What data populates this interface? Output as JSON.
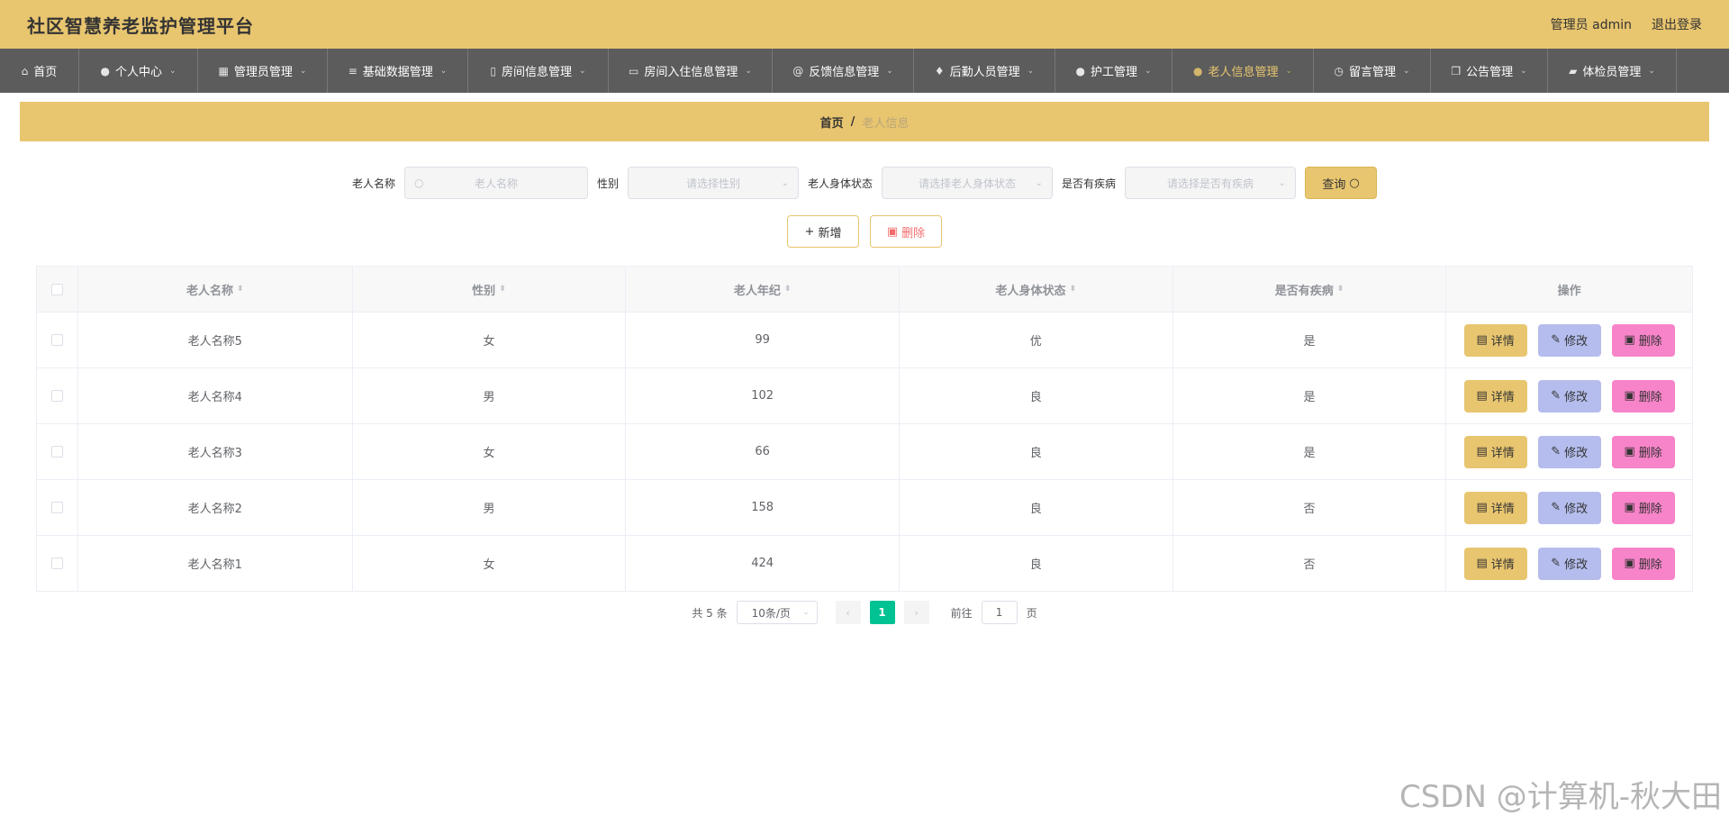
{
  "header": {
    "title": "社区智慧养老监护管理平台",
    "user": "管理员 admin",
    "logout": "退出登录"
  },
  "nav": {
    "items": [
      {
        "label": "首页",
        "icon": "home-icon"
      },
      {
        "label": "个人中心",
        "icon": "user-icon"
      },
      {
        "label": "管理员管理",
        "icon": "grid-icon"
      },
      {
        "label": "基础数据管理",
        "icon": "sliders-icon"
      },
      {
        "label": "房间信息管理",
        "icon": "phone-icon"
      },
      {
        "label": "房间入住信息管理",
        "icon": "briefcase-icon"
      },
      {
        "label": "反馈信息管理",
        "icon": "at-icon"
      },
      {
        "label": "后勤人员管理",
        "icon": "mic-icon"
      },
      {
        "label": "护工管理",
        "icon": "person-icon"
      },
      {
        "label": "老人信息管理",
        "icon": "user-icon"
      },
      {
        "label": "留言管理",
        "icon": "clock-icon"
      },
      {
        "label": "公告管理",
        "icon": "copy-icon"
      },
      {
        "label": "体检员管理",
        "icon": "camera-icon"
      }
    ]
  },
  "breadcrumb": {
    "home": "首页",
    "sep": "/",
    "current": "老人信息"
  },
  "search": {
    "name_label": "老人名称",
    "name_placeholder": "老人名称",
    "gender_label": "性别",
    "gender_placeholder": "请选择性别",
    "health_label": "老人身体状态",
    "health_placeholder": "请选择老人身体状态",
    "disease_label": "是否有疾病",
    "disease_placeholder": "请选择是否有疾病",
    "query_label": "查询"
  },
  "actions": {
    "add_label": "新增",
    "delete_label": "删除"
  },
  "table": {
    "columns": [
      "老人名称",
      "性别",
      "老人年纪",
      "老人身体状态",
      "是否有疾病",
      "操作"
    ],
    "rows": [
      {
        "name": "老人名称5",
        "gender": "女",
        "age": "99",
        "health": "优",
        "disease": "是"
      },
      {
        "name": "老人名称4",
        "gender": "男",
        "age": "102",
        "health": "良",
        "disease": "是"
      },
      {
        "name": "老人名称3",
        "gender": "女",
        "age": "66",
        "health": "良",
        "disease": "是"
      },
      {
        "name": "老人名称2",
        "gender": "男",
        "age": "158",
        "health": "良",
        "disease": "否"
      },
      {
        "name": "老人名称1",
        "gender": "女",
        "age": "424",
        "health": "良",
        "disease": "否"
      }
    ],
    "op_detail": "详情",
    "op_edit": "修改",
    "op_delete": "删除"
  },
  "pager": {
    "total": "共 5 条",
    "page_size": "10条/页",
    "current_page": "1",
    "goto_label": "前往",
    "goto_value": "1",
    "page_suffix": "页"
  },
  "watermark": "CSDN @计算机-秋大田",
  "colors": {
    "accent": "#e8c56f",
    "nav_bg": "#5c5c5c",
    "edit": "#b5bdee",
    "delete": "#f783c8",
    "page_active": "#00c292"
  }
}
